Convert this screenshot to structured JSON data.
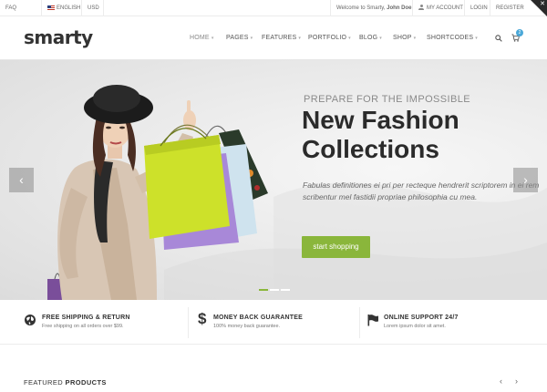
{
  "topbar": {
    "faq": "FAQ",
    "language": "ENGLISH",
    "currency": "USD",
    "welcome_prefix": "Welcome to Smarty,",
    "user_name": "John Doe",
    "my_account": "MY ACCOUNT",
    "login": "LOGIN",
    "register": "REGISTER"
  },
  "header": {
    "logo": "smarty",
    "nav": [
      {
        "label": "HOME"
      },
      {
        "label": "PAGES"
      },
      {
        "label": "FEATURES"
      },
      {
        "label": "PORTFOLIO"
      },
      {
        "label": "BLOG"
      },
      {
        "label": "SHOP"
      },
      {
        "label": "SHORTCODES"
      }
    ],
    "cart_count": "2"
  },
  "hero": {
    "subtitle": "PREPARE FOR THE IMPOSSIBLE",
    "title_line1": "New Fashion",
    "title_line2": "Collections",
    "description": "Fabulas definitiones ei pri per recteque hendrerit scriptorem in ei rem scribentur mel fastidii propriae philosophia cu mea.",
    "cta_label": "start shopping",
    "prev_arrow": "‹",
    "next_arrow": "›",
    "slides_count": 3,
    "active_slide": 1
  },
  "features": [
    {
      "icon": "globe-icon",
      "title": "FREE SHIPPING & RETURN",
      "text": "Free shipping on all orders over $99."
    },
    {
      "icon": "dollar-icon",
      "title": "MONEY BACK GUARANTEE",
      "text": "100% money back guarantee."
    },
    {
      "icon": "flag-icon",
      "title": "ONLINE SUPPORT 24/7",
      "text": "Lorem ipsum dolor sit amet."
    }
  ],
  "featured": {
    "heading_light": "FEATURED",
    "heading_bold": "PRODUCTS",
    "prev_arrow": "‹",
    "next_arrow": "›"
  },
  "colors": {
    "accent_green": "#8ab63b",
    "badge_blue": "#4aa8d8",
    "text_dark": "#2b2b2b"
  }
}
